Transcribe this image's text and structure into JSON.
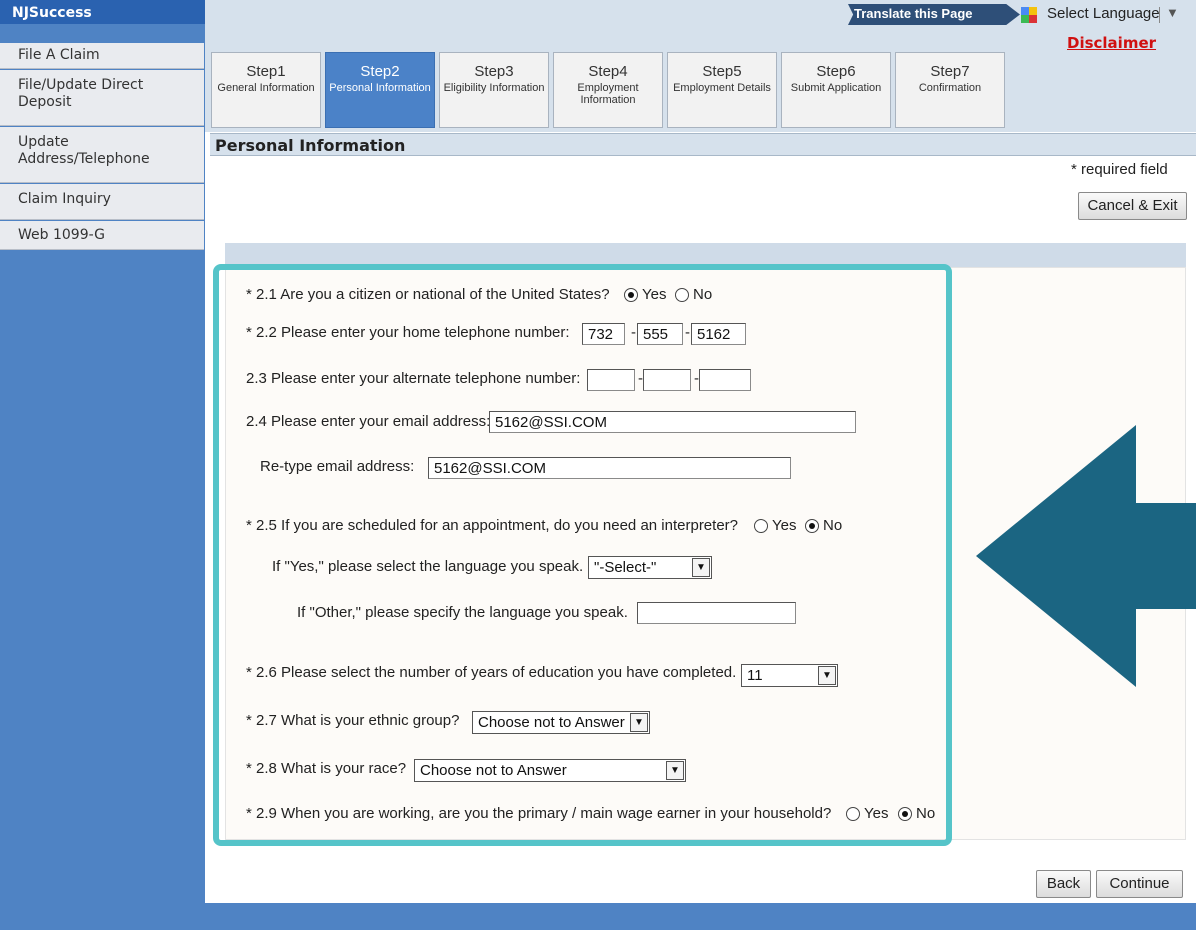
{
  "sidebar": {
    "brand": "NJSuccess",
    "items": [
      {
        "label": "File A Claim"
      },
      {
        "label": "File/Update Direct Deposit"
      },
      {
        "label": "Update Address/Telephone"
      },
      {
        "label": "Claim Inquiry"
      },
      {
        "label": "Web 1099-G"
      }
    ]
  },
  "header": {
    "translate_label": "Translate this Page",
    "select_language_label": "Select Language",
    "language_arrow": "▼",
    "disclaimer_label": "Disclaimer"
  },
  "steps": [
    {
      "title": "Step1",
      "subtitle": "General Information",
      "active": false
    },
    {
      "title": "Step2",
      "subtitle": "Personal Information",
      "active": true
    },
    {
      "title": "Step3",
      "subtitle": "Eligibility Information",
      "active": false
    },
    {
      "title": "Step4",
      "subtitle": "Employment Information",
      "active": false
    },
    {
      "title": "Step5",
      "subtitle": "Employment Details",
      "active": false
    },
    {
      "title": "Step6",
      "subtitle": "Submit Application",
      "active": false
    },
    {
      "title": "Step7",
      "subtitle": "Confirmation",
      "active": false
    }
  ],
  "section": {
    "title": "Personal Information",
    "required_note": "* required field",
    "cancel_label": "Cancel & Exit"
  },
  "form": {
    "q1": {
      "label": "*  2.1 Are you a citizen or national of the United States?",
      "yes": "Yes",
      "no": "No",
      "selected": "Yes"
    },
    "q2": {
      "label": "*  2.2 Please enter your home telephone number:",
      "area": "732",
      "prefix": "555",
      "line": "5162"
    },
    "q3": {
      "label": "2.3 Please enter your alternate telephone number:",
      "area": "",
      "prefix": "",
      "line": ""
    },
    "q4": {
      "label": "2.4 Please enter your email address:",
      "value": "5162@SSI.COM",
      "retype_label": "Re-type email address:",
      "retype_value": "5162@SSI.COM"
    },
    "q5": {
      "label": "*  2.5 If you are scheduled for an appointment, do you need an interpreter?",
      "yes": "Yes",
      "no": "No",
      "selected": "No",
      "lang_label": "If \"Yes,\" please select the language you speak.",
      "lang_value": "\"-Select-\"",
      "other_label": "If \"Other,\" please specify the language you speak.",
      "other_value": ""
    },
    "q6": {
      "label": "*  2.6 Please select the number of years of education you have completed.",
      "value": "11"
    },
    "q7": {
      "label": "*  2.7 What is your ethnic group?",
      "value": "Choose not to Answer"
    },
    "q8": {
      "label": "*  2.8 What is your race?",
      "value": "Choose not to Answer"
    },
    "q9": {
      "label": "*  2.9 When you are working, are you the primary / main wage earner in your household?",
      "yes": "Yes",
      "no": "No",
      "selected": "No"
    },
    "dash": "-"
  },
  "footer": {
    "back_label": "Back",
    "continue_label": "Continue"
  },
  "colors": {
    "sidebar": "#4f83c4",
    "highlight": "#55c4c9",
    "arrow": "#1b6582",
    "disclaimer": "#d01010"
  }
}
